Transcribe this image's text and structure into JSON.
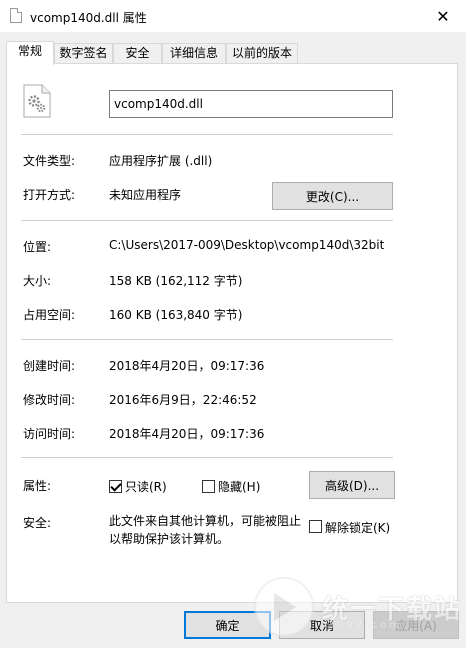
{
  "window": {
    "title": "vcomp140d.dll 属性",
    "close_glyph": "✕"
  },
  "tabs": [
    {
      "label": "常规"
    },
    {
      "label": "数字签名"
    },
    {
      "label": "安全"
    },
    {
      "label": "详细信息"
    },
    {
      "label": "以前的版本"
    }
  ],
  "general": {
    "filename": "vcomp140d.dll",
    "file_type_label": "文件类型:",
    "file_type_value": "应用程序扩展 (.dll)",
    "opens_with_label": "打开方式:",
    "opens_with_value": "未知应用程序",
    "change_button": "更改(C)...",
    "location_label": "位置:",
    "location_value": "C:\\Users\\2017-009\\Desktop\\vcomp140d\\32bit",
    "size_label": "大小:",
    "size_value": "158 KB (162,112 字节)",
    "size_on_disk_label": "占用空间:",
    "size_on_disk_value": "160 KB (163,840 字节)",
    "created_label": "创建时间:",
    "created_value": "2018年4月20日，09:17:36",
    "modified_label": "修改时间:",
    "modified_value": "2016年6月9日，22:46:52",
    "accessed_label": "访问时间:",
    "accessed_value": "2018年4月20日，09:17:36",
    "attributes_label": "属性:",
    "readonly_label": "只读(R)",
    "readonly_checked": true,
    "hidden_label": "隐藏(H)",
    "hidden_checked": false,
    "advanced_button": "高级(D)...",
    "security_label": "安全:",
    "security_text": "此文件来自其他计算机，可能被阻止以帮助保护该计算机。",
    "unblock_label": "解除锁定(K)",
    "unblock_checked": false
  },
  "footer": {
    "ok_button": "确定",
    "cancel_button": "取消",
    "apply_button": "应用(A)"
  },
  "watermark": {
    "text": "统一下载站",
    "sub": "3987.com"
  },
  "colors": {
    "focus_border": "#0078d7",
    "button_face": "#e1e1e1",
    "dialog_bg": "#f0f0f0"
  }
}
